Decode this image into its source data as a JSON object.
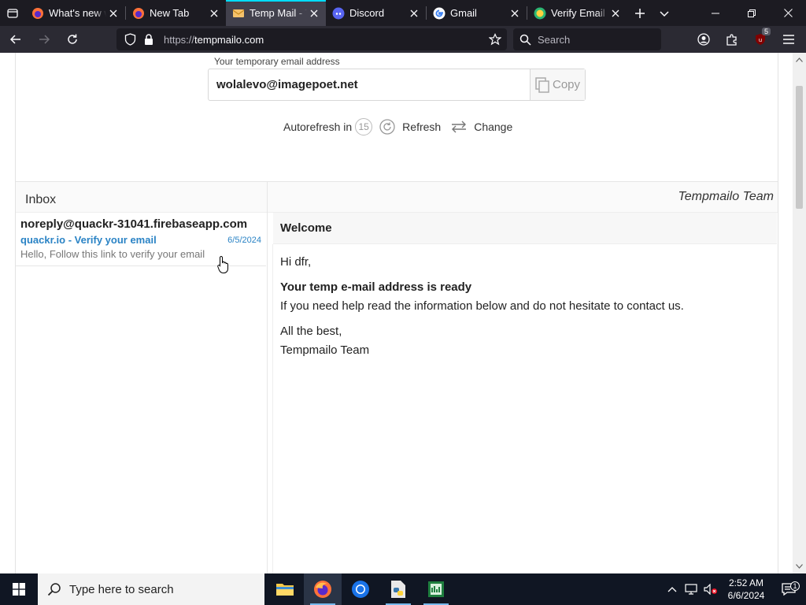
{
  "browser": {
    "tabs": [
      {
        "title": "What's new with Firefox",
        "favicon": "firefox-icon",
        "active": false
      },
      {
        "title": "New Tab",
        "favicon": "firefox-icon",
        "active": false
      },
      {
        "title": "Temp Mail - Tempmailo",
        "favicon": "envelope-icon",
        "active": true
      },
      {
        "title": "Discord",
        "favicon": "discord-icon",
        "active": false
      },
      {
        "title": "Gmail",
        "favicon": "google-icon",
        "active": false
      },
      {
        "title": "Verify Email | Quackr",
        "favicon": "quackr-icon",
        "active": false
      }
    ],
    "url_scheme": "https://",
    "url_host": "tempmailo.com",
    "search_placeholder": "Search",
    "extension_badge": "5"
  },
  "page": {
    "address_label": "Your temporary email address",
    "address": "wolalevo@imagepoet.net",
    "copy_label": "Copy",
    "autorefresh_label": "Autorefresh in",
    "autorefresh_seconds": "15",
    "refresh_label": "Refresh",
    "change_label": "Change",
    "inbox_title": "Inbox",
    "team_signature": "Tempmailo Team",
    "inbox": [
      {
        "from": "noreply@quackr-31041.firebaseapp.com",
        "subject": "quackr.io - Verify your email",
        "date": "6/5/2024",
        "preview": "Hello, Follow this link to verify your email"
      }
    ],
    "message": {
      "subject": "Welcome",
      "greeting": "Hi dfr,",
      "headline": "Your temp e-mail address is ready",
      "line1": "If you need help read the information below and do not hesitate to contact us.",
      "closing1": "All the best,",
      "closing2": "Tempmailo Team"
    }
  },
  "taskbar": {
    "search_placeholder": "Type here to search",
    "time": "2:52 AM",
    "date": "6/6/2024",
    "notification_count": "1"
  }
}
